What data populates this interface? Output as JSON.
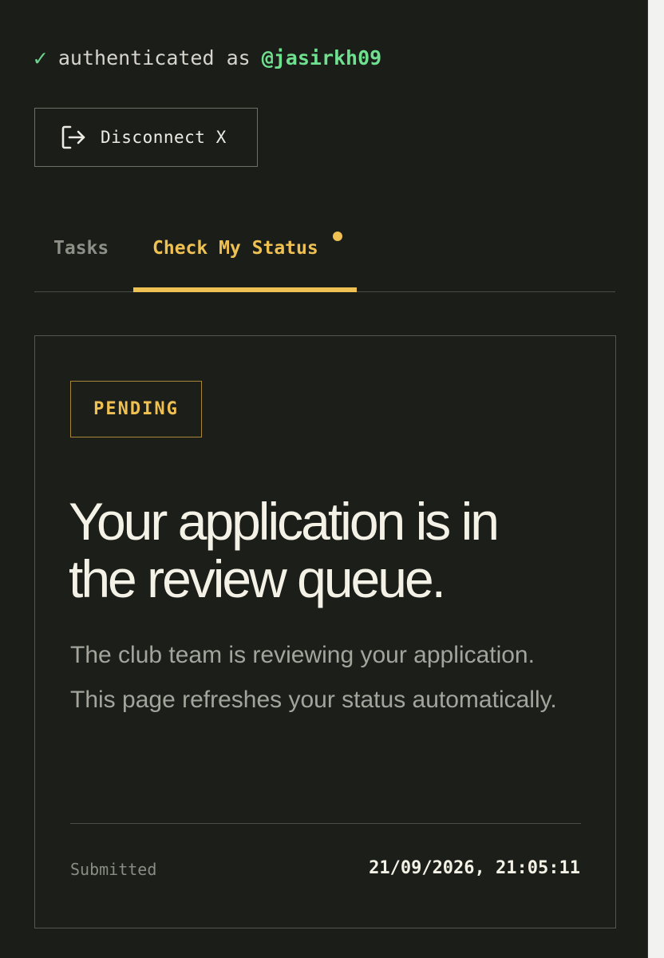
{
  "auth": {
    "check_icon": "✓",
    "prefix": "authenticated as",
    "username": "@jasirkh09"
  },
  "disconnect": {
    "icon": "logout-icon",
    "label": "Disconnect X"
  },
  "tabs": [
    {
      "label": "Tasks",
      "active": false
    },
    {
      "label": "Check My Status",
      "active": true,
      "has_notification_dot": true
    }
  ],
  "status_card": {
    "badge": "PENDING",
    "headline_line1": "Your application is in",
    "headline_line2": "the review queue.",
    "description": "The club team is reviewing your application. This page refreshes your status automatically.",
    "submitted_label": "Submitted",
    "submitted_value": "21/09/2026, 21:05:11"
  },
  "colors": {
    "background": "#1b1d19",
    "accent": "#efc153",
    "success": "#6fe08f",
    "text": "#f4f1e6",
    "muted": "#a3a49b"
  }
}
